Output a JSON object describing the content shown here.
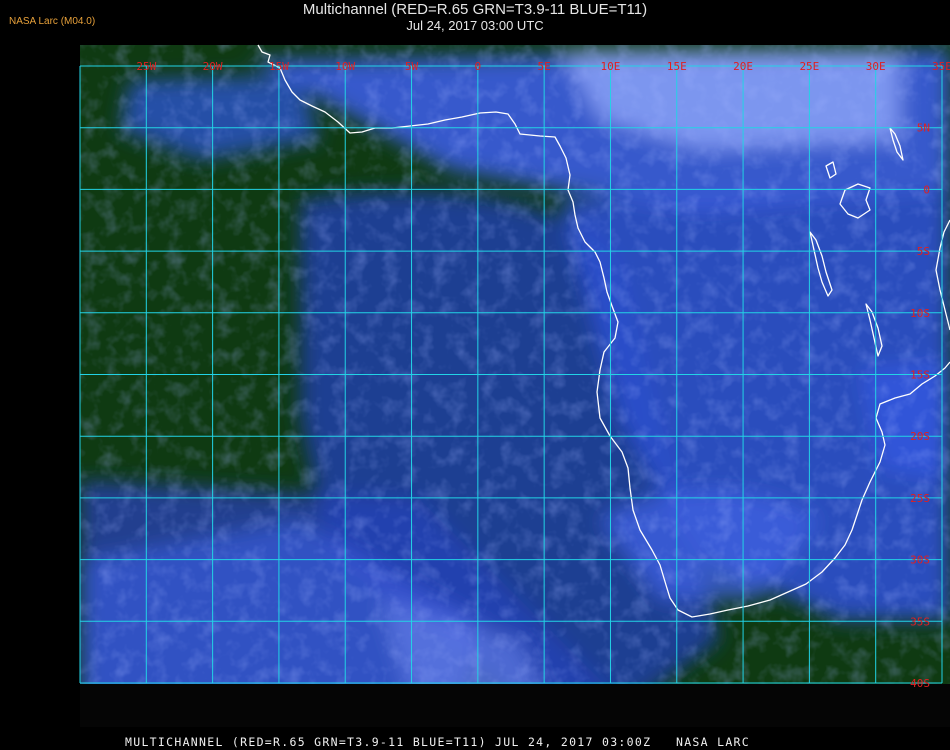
{
  "header": {
    "brand": "NASA Larc (M04.0)",
    "title": "Multichannel (RED=R.65 GRN=T3.9-11 BLUE=T11)",
    "subtitle": "Jul 24, 2017 03:00 UTC"
  },
  "footer": {
    "caption": "MULTICHANNEL (RED=R.65 GRN=T3.9-11 BLUE=T11) JUL 24, 2017 03:00Z   NASA LARC"
  },
  "map": {
    "lon_range": [
      -30,
      35
    ],
    "lat_range": [
      -40,
      10
    ],
    "lon_labels": [
      {
        "lon": -25,
        "text": "25W"
      },
      {
        "lon": -20,
        "text": "20W"
      },
      {
        "lon": -15,
        "text": "15W"
      },
      {
        "lon": -10,
        "text": "10W"
      },
      {
        "lon": -5,
        "text": "5W"
      },
      {
        "lon": 0,
        "text": "0"
      },
      {
        "lon": 5,
        "text": "5E"
      },
      {
        "lon": 10,
        "text": "10E"
      },
      {
        "lon": 15,
        "text": "15E"
      },
      {
        "lon": 20,
        "text": "20E"
      },
      {
        "lon": 25,
        "text": "25E"
      },
      {
        "lon": 30,
        "text": "30E"
      },
      {
        "lon": 35,
        "text": "35E"
      }
    ],
    "lat_labels": [
      {
        "lat": 5,
        "text": "5N"
      },
      {
        "lat": 0,
        "text": "0"
      },
      {
        "lat": -5,
        "text": "5S"
      },
      {
        "lat": -10,
        "text": "10S"
      },
      {
        "lat": -15,
        "text": "15S"
      },
      {
        "lat": -20,
        "text": "20S"
      },
      {
        "lat": -25,
        "text": "25S"
      },
      {
        "lat": -30,
        "text": "30S"
      },
      {
        "lat": -35,
        "text": "35S"
      },
      {
        "lat": -40,
        "text": "40S"
      }
    ],
    "colors": {
      "grid": "#22d3e6",
      "label": "#e02020",
      "coast": "#ffffff",
      "ocean_clear": "#0f3a12",
      "cloud_low": "#2a45c8",
      "cloud_high": "#aac0ff"
    }
  }
}
